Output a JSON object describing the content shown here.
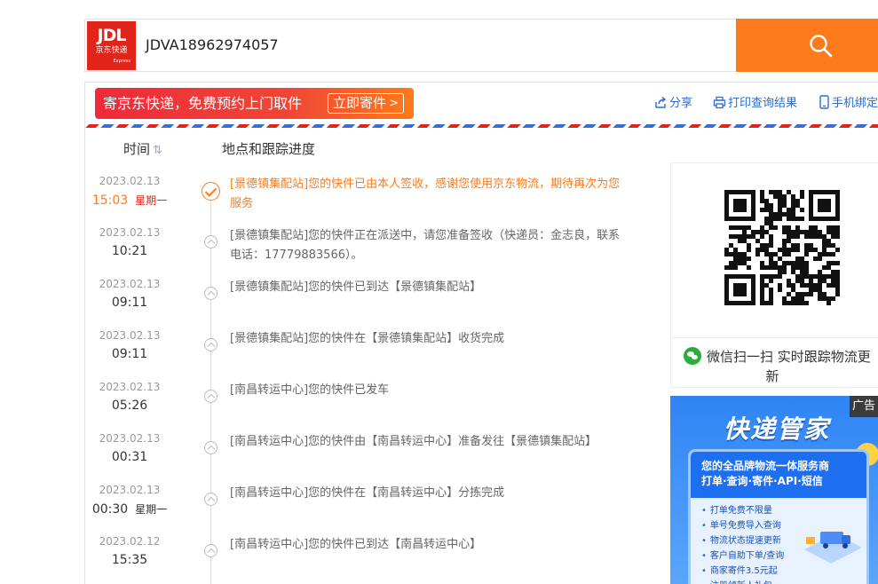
{
  "search": {
    "logo_brand": "JDL",
    "logo_cn": "京东快递",
    "logo_en": "Express",
    "query": "JDVA18962974057"
  },
  "banner": {
    "text": "寄京东快递，免费预约上门取件",
    "button_label": "立即寄件",
    "button_arrow": ">"
  },
  "tools": {
    "share": "分享",
    "print": "打印查询结果",
    "phone_bind": "手机绑定"
  },
  "columns": {
    "time": "时间",
    "location": "地点和跟踪进度"
  },
  "tracking": [
    {
      "date": "2023.02.13",
      "time": "15:03",
      "weekday": "星期一",
      "message": "[景德镇集配站]您的快件已由本人签收，感谢您使用京东物流，期待再次为您服务",
      "status": "done"
    },
    {
      "date": "2023.02.13",
      "time": "10:21",
      "weekday": "",
      "message": "[景德镇集配站]您的快件正在派送中，请您准备签收（快递员：金志良，联系电话：17779883566）。",
      "status": "normal"
    },
    {
      "date": "2023.02.13",
      "time": "09:11",
      "weekday": "",
      "message": "[景德镇集配站]您的快件已到达【景德镇集配站】",
      "status": "normal"
    },
    {
      "date": "2023.02.13",
      "time": "09:11",
      "weekday": "",
      "message": "[景德镇集配站]您的快件在【景德镇集配站】收货完成",
      "status": "normal"
    },
    {
      "date": "2023.02.13",
      "time": "05:26",
      "weekday": "",
      "message": "[南昌转运中心]您的快件已发车",
      "status": "normal"
    },
    {
      "date": "2023.02.13",
      "time": "00:31",
      "weekday": "",
      "message": "[南昌转运中心]您的快件由【南昌转运中心】准备发往【景德镇集配站】",
      "status": "normal"
    },
    {
      "date": "2023.02.13",
      "time": "00:30",
      "weekday": "星期一",
      "message": "[南昌转运中心]您的快件在【南昌转运中心】分拣完成",
      "status": "normal"
    },
    {
      "date": "2023.02.12",
      "time": "15:35",
      "weekday": "",
      "message": "[南昌转运中心]您的快件已到达【南昌转运中心】",
      "status": "normal"
    }
  ],
  "qr": {
    "caption_line1": "微信扫一扫 实时跟踪物流更",
    "caption_line2": "新"
  },
  "ad": {
    "badge": "广告",
    "title": "快递管家",
    "headline_1": "您的全品牌物流一体服务商",
    "headline_2": "打单·查询·寄件·API·短信",
    "features": [
      "打单免费不限量",
      "单号免费导入查询",
      "物流状态提速更新",
      "客户自助下单/查询",
      "商家寄件3.5元起",
      "注册领新人礼包"
    ]
  },
  "colors": {
    "accent_orange": "#ff7a1a",
    "brand_red": "#e1251b",
    "link_blue": "#2c6ccf"
  }
}
